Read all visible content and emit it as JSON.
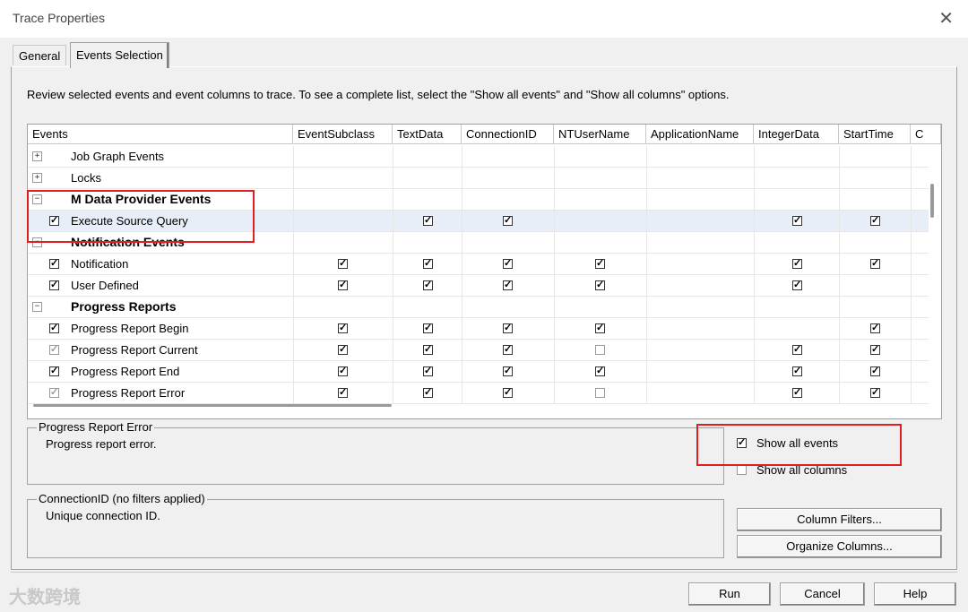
{
  "window": {
    "title": "Trace Properties"
  },
  "tabs": [
    {
      "label": "General"
    },
    {
      "label": "Events Selection"
    }
  ],
  "description": "Review selected events and event columns to trace. To see a complete list, select the \"Show all events\" and \"Show all columns\" options.",
  "grid": {
    "columns": [
      "Events",
      "EventSubclass",
      "TextData",
      "ConnectionID",
      "NTUserName",
      "ApplicationName",
      "IntegerData",
      "StartTime",
      "C"
    ],
    "rows": [
      {
        "type": "category",
        "label": "Job Graph Events",
        "expanded": false,
        "bold": false
      },
      {
        "type": "category",
        "label": "Locks",
        "expanded": false,
        "bold": false
      },
      {
        "type": "category",
        "label": "M Data Provider Events",
        "expanded": true,
        "bold": true
      },
      {
        "type": "event",
        "label": "Execute Source Query",
        "checked": "checked",
        "cells": [
          "",
          "checked",
          "checked",
          "",
          "",
          "checked",
          "checked"
        ],
        "selected": true
      },
      {
        "type": "category",
        "label": "Notification Events",
        "expanded": true,
        "bold": true
      },
      {
        "type": "event",
        "label": "Notification",
        "checked": "checked",
        "cells": [
          "checked",
          "checked",
          "checked",
          "checked",
          "",
          "checked",
          "checked"
        ]
      },
      {
        "type": "event",
        "label": "User Defined",
        "checked": "checked",
        "cells": [
          "checked",
          "checked",
          "checked",
          "checked",
          "",
          "checked",
          ""
        ]
      },
      {
        "type": "category",
        "label": "Progress Reports",
        "expanded": true,
        "bold": true
      },
      {
        "type": "event",
        "label": "Progress Report Begin",
        "checked": "checked",
        "cells": [
          "checked",
          "checked",
          "checked",
          "checked",
          "",
          "",
          "checked"
        ]
      },
      {
        "type": "event",
        "label": "Progress Report Current",
        "checked": "gray",
        "cells": [
          "checked",
          "checked",
          "checked",
          "empty",
          "",
          "checked",
          "checked"
        ]
      },
      {
        "type": "event",
        "label": "Progress Report End",
        "checked": "checked",
        "cells": [
          "checked",
          "checked",
          "checked",
          "checked",
          "",
          "checked",
          "checked"
        ]
      },
      {
        "type": "event",
        "label": "Progress Report Error",
        "checked": "gray",
        "cells": [
          "checked",
          "checked",
          "checked",
          "empty",
          "",
          "checked",
          "checked"
        ]
      }
    ]
  },
  "event_info": {
    "title": "Progress Report Error",
    "text": "Progress report error."
  },
  "column_info": {
    "title": "ConnectionID (no filters applied)",
    "text": "Unique connection ID."
  },
  "options": {
    "show_all_events": "Show all events",
    "show_all_events_checked": true,
    "show_all_columns": "Show all columns",
    "show_all_columns_checked": false
  },
  "buttons": {
    "column_filters": "Column Filters...",
    "organize_columns": "Organize Columns...",
    "run": "Run",
    "cancel": "Cancel",
    "help": "Help"
  },
  "icons": {
    "close": "close-icon",
    "check": "checkmark-icon",
    "expand": "plus-expander-icon",
    "collapse": "minus-expander-icon"
  },
  "watermark": "大数跨境",
  "colors": {
    "highlight": "#e02020",
    "selected_row": "#e8eef7"
  }
}
